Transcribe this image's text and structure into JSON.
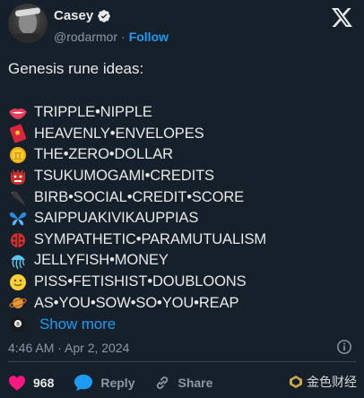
{
  "author": {
    "name": "Casey",
    "handle": "@rodarmor",
    "follow_label": "Follow",
    "separator": "·"
  },
  "post": {
    "headline": "Genesis rune ideas:",
    "items": [
      {
        "icon": "lips-emoji",
        "text": "TRIPPLE•NIPPLE"
      },
      {
        "icon": "red-envelope-emoji",
        "text": "HEAVENLY•ENVELOPES"
      },
      {
        "icon": "coin-emoji",
        "text": "THE•ZERO•DOLLAR"
      },
      {
        "icon": "ogre-emoji",
        "text": "TSUKUMOGAMI•CREDITS"
      },
      {
        "icon": "crow-emoji",
        "text": "BIRB•SOCIAL•CREDIT•SCORE"
      },
      {
        "icon": "butterfly-emoji",
        "text": "SAIPPUAKIVIKAUPPIAS"
      },
      {
        "icon": "ladybug-emoji",
        "text": "SYMPATHETIC•PARAMUTUALISM"
      },
      {
        "icon": "jellyfish-emoji",
        "text": "JELLYFISH•MONEY"
      },
      {
        "icon": "smiley-emoji",
        "text": "PISS•FETISHIST•DOUBLOONS"
      },
      {
        "icon": "ringed-planet-emoji",
        "text": "AS•YOU•SOW•SO•YOU•REAP"
      }
    ],
    "last_icon": "pool-8-ball-emoji",
    "show_more_label": "Show more",
    "timestamp": "4:46 AM · Apr 2, 2024"
  },
  "actions": {
    "like_count": "968",
    "reply_label": "Reply",
    "share_label": "Share"
  },
  "watermark": "金色财经",
  "colors": {
    "background": "#15202b",
    "text": "#e7e9ea",
    "muted": "#8b98a5",
    "accent": "#1d9bf0",
    "like": "#f91880"
  }
}
